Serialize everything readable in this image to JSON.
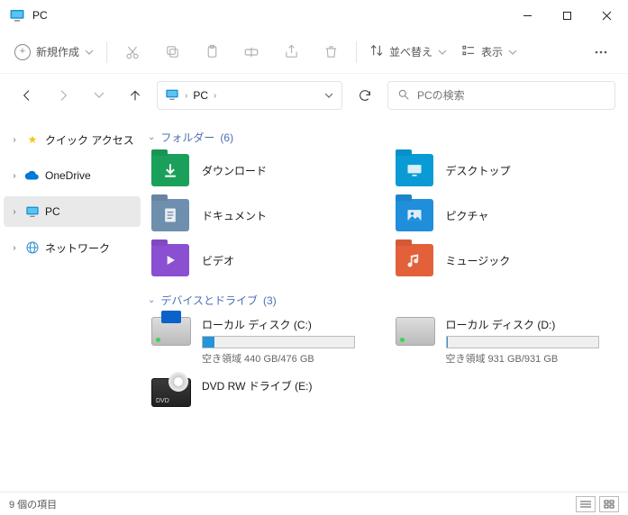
{
  "window": {
    "title": "PC"
  },
  "toolbar": {
    "new_label": "新規作成",
    "sort_label": "並べ替え",
    "view_label": "表示"
  },
  "address": {
    "crumb": "PC"
  },
  "search": {
    "placeholder": "PCの検索"
  },
  "sidebar": {
    "items": [
      {
        "label": "クイック アクセス"
      },
      {
        "label": "OneDrive"
      },
      {
        "label": "PC"
      },
      {
        "label": "ネットワーク"
      }
    ]
  },
  "groups": {
    "folders": {
      "title": "フォルダー",
      "count": "(6)"
    },
    "drives": {
      "title": "デバイスとドライブ",
      "count": "(3)"
    }
  },
  "folders": [
    {
      "label": "ダウンロード",
      "color": "#1aa05a",
      "icon": "download"
    },
    {
      "label": "デスクトップ",
      "color": "#0a9bd6",
      "icon": "desktop"
    },
    {
      "label": "ドキュメント",
      "color": "#6f8fae",
      "icon": "document"
    },
    {
      "label": "ピクチャ",
      "color": "#1f8edb",
      "icon": "picture"
    },
    {
      "label": "ビデオ",
      "color": "#8b4fd1",
      "icon": "video"
    },
    {
      "label": "ミュージック",
      "color": "#e2613a",
      "icon": "music"
    }
  ],
  "drives": [
    {
      "name": "ローカル ディスク (C:)",
      "free_text": "空き領域 440 GB/476 GB",
      "fill_pct": 8,
      "kind": "windisk"
    },
    {
      "name": "ローカル ディスク (D:)",
      "free_text": "空き領域 931 GB/931 GB",
      "fill_pct": 0.5,
      "kind": "disk"
    },
    {
      "name": "DVD RW ドライブ (E:)",
      "free_text": "",
      "fill_pct": null,
      "kind": "dvd"
    }
  ],
  "status": {
    "text": "9 個の項目"
  }
}
